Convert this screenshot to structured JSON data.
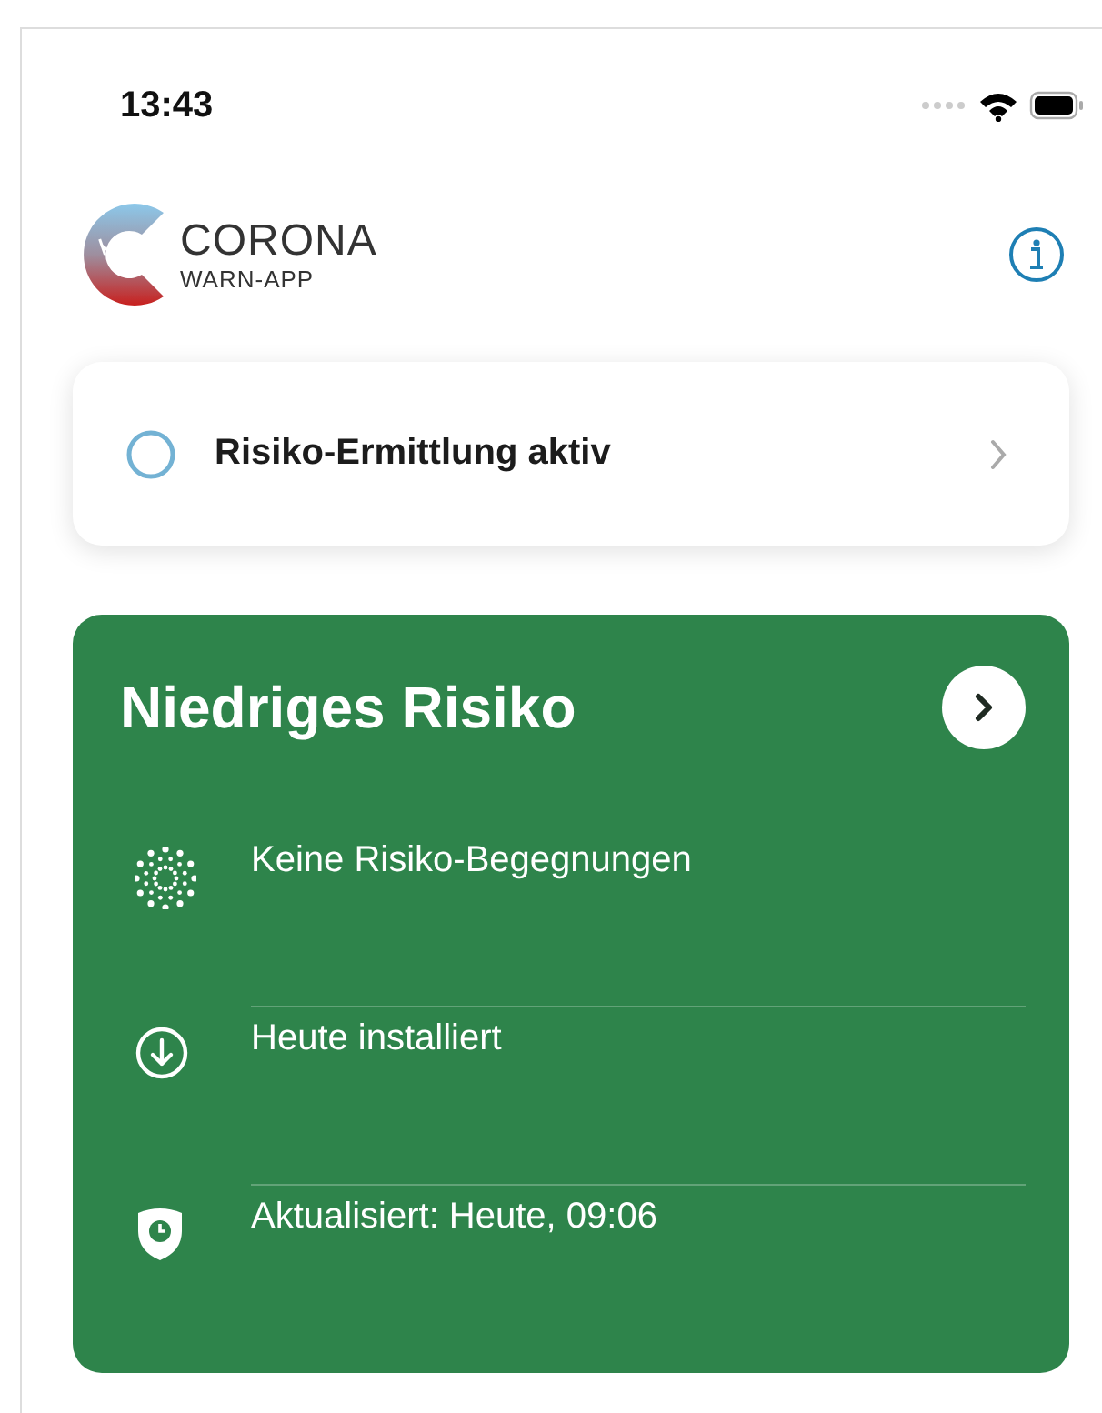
{
  "status_bar": {
    "time": "13:43"
  },
  "header": {
    "logo_title": "CORONA",
    "logo_subtitle": "WARN-APP"
  },
  "tracing_card": {
    "label": "Risiko-Ermittlung aktiv"
  },
  "risk_card": {
    "title": "Niedriges Risiko",
    "rows": [
      {
        "kind": "encounters",
        "text": "Keine Risiko-Begegnungen"
      },
      {
        "kind": "installed",
        "text": "Heute installiert"
      },
      {
        "kind": "updated",
        "text": "Aktualisiert: Heute, 09:06"
      }
    ]
  }
}
